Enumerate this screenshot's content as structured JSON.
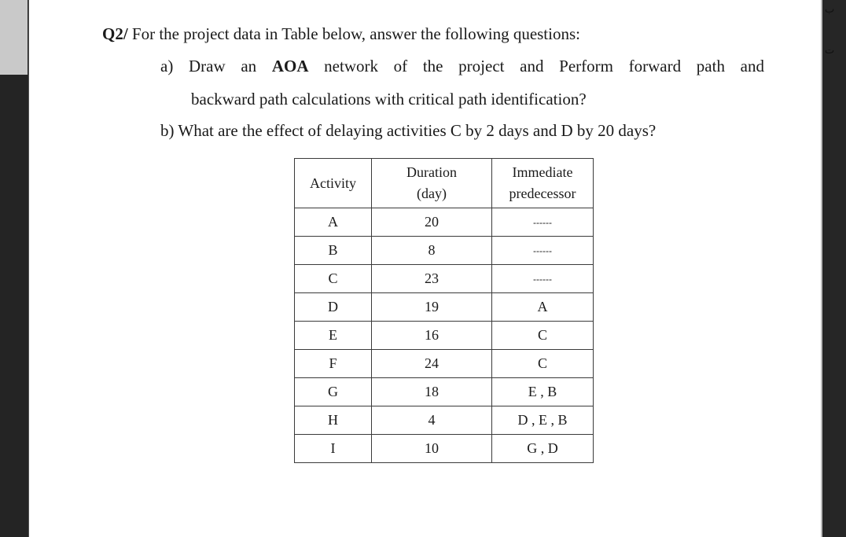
{
  "question": {
    "label": "Q2/",
    "intro": "For the project data in Table below, answer the following questions:",
    "part_a": {
      "marker": "a)",
      "words_line1": [
        "Draw",
        "an",
        "AOA",
        "network",
        "of",
        "the",
        "project",
        "and",
        "Perform",
        "forward",
        "path",
        "and"
      ],
      "bold_word": "AOA",
      "line2": "backward path calculations with critical path identification?"
    },
    "part_b": {
      "marker": "b)",
      "text": "What are the effect of delaying activities C by 2 days and D by 20 days?"
    }
  },
  "table": {
    "headers": {
      "activity": "Activity",
      "duration_line1": "Duration",
      "duration_line2": "(day)",
      "predecessor_line1": "Immediate",
      "predecessor_line2": "predecessor"
    },
    "rows": [
      {
        "activity": "A",
        "duration": "20",
        "predecessor": "------"
      },
      {
        "activity": "B",
        "duration": "8",
        "predecessor": "------"
      },
      {
        "activity": "C",
        "duration": "23",
        "predecessor": "------"
      },
      {
        "activity": "D",
        "duration": "19",
        "predecessor": "A"
      },
      {
        "activity": "E",
        "duration": "16",
        "predecessor": "C"
      },
      {
        "activity": "F",
        "duration": "24",
        "predecessor": "C"
      },
      {
        "activity": "G",
        "duration": "18",
        "predecessor": "E , B"
      },
      {
        "activity": "H",
        "duration": "4",
        "predecessor": "D , E , B"
      },
      {
        "activity": "I",
        "duration": "10",
        "predecessor": "G , D"
      }
    ]
  },
  "side_panels": {
    "right_glyphs": [
      "ب",
      "ت"
    ]
  }
}
